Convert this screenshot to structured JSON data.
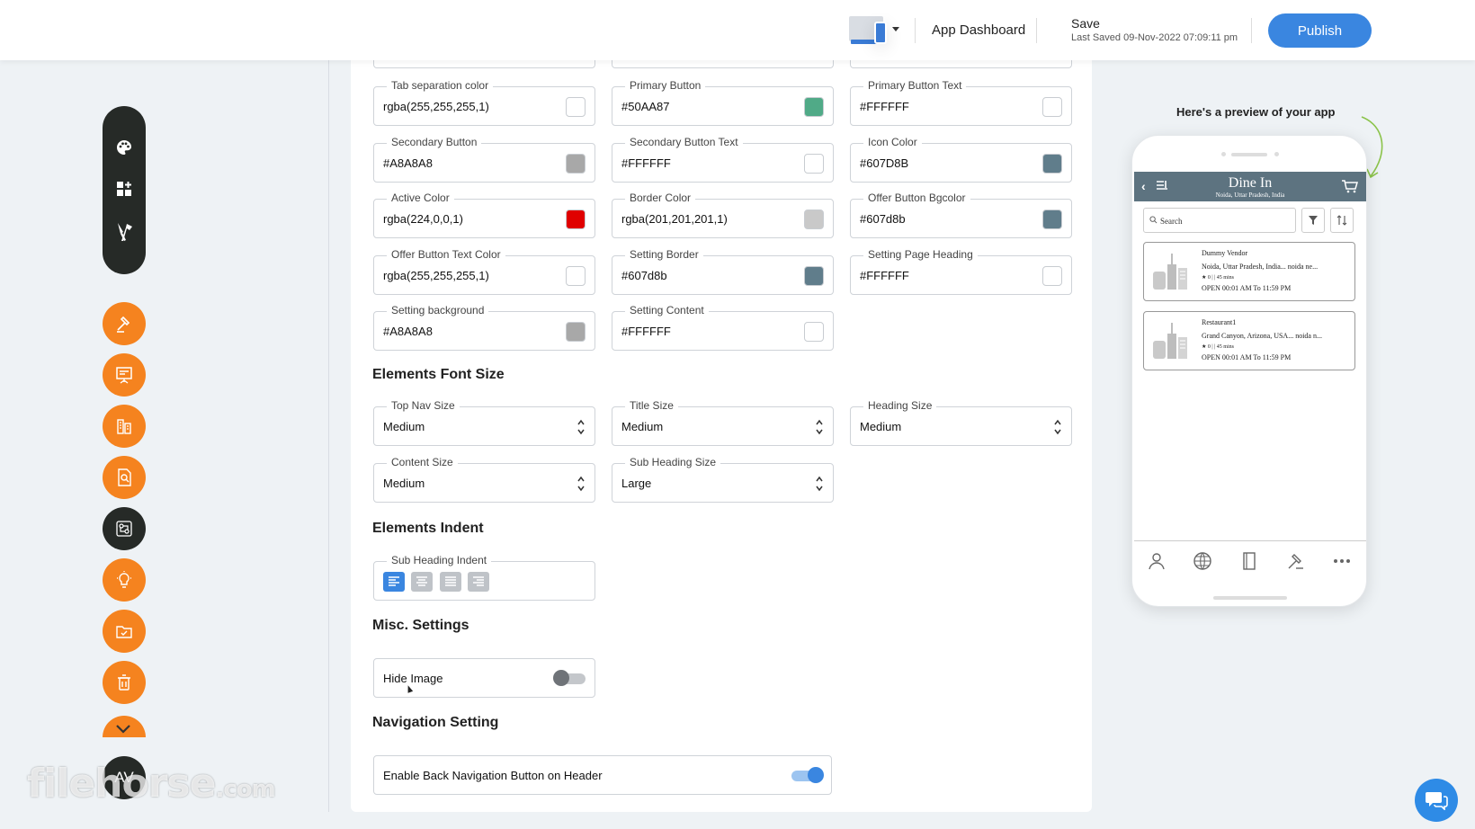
{
  "header": {
    "device_icon": "desktop-mobile-icon",
    "dashboard_label": "App Dashboard",
    "save_title": "Save",
    "last_saved": "Last Saved 09-Nov-2022 07:09:11 pm",
    "publish_label": "Publish",
    "accent": "#3a86e0"
  },
  "sidebar": {
    "pill_icons": [
      "palette-icon",
      "add-widget-icon",
      "tools-icon"
    ],
    "items": [
      "hammer-icon",
      "presentation-icon",
      "building-icon",
      "document-search-icon",
      "workflow-icon",
      "lightbulb-icon",
      "folder-check-icon",
      "trash-icon"
    ],
    "active_item": "workflow-icon",
    "avatar_initials": "AV",
    "accent": "#f5831f"
  },
  "watermark": {
    "main": "filehorse",
    "tld": ".com"
  },
  "colors": {
    "fields": [
      {
        "label": "Tab separation color",
        "value": "rgba(255,255,255,1)",
        "swatch": "#ffffff"
      },
      {
        "label": "Primary Button",
        "value": "#50AA87",
        "swatch": "#50AA87"
      },
      {
        "label": "Primary Button Text",
        "value": "#FFFFFF",
        "swatch": "#ffffff"
      },
      {
        "label": "Secondary Button",
        "value": "#A8A8A8",
        "swatch": "#A8A8A8"
      },
      {
        "label": "Secondary Button Text",
        "value": "#FFFFFF",
        "swatch": "#ffffff"
      },
      {
        "label": "Icon Color",
        "value": "#607D8B",
        "swatch": "#607D8B"
      },
      {
        "label": "Active Color",
        "value": "rgba(224,0,0,1)",
        "swatch": "#e00000"
      },
      {
        "label": "Border Color",
        "value": "rgba(201,201,201,1)",
        "swatch": "#c9c9c9"
      },
      {
        "label": "Offer Button Bgcolor",
        "value": "#607d8b",
        "swatch": "#607d8b"
      },
      {
        "label": "Offer Button Text Color",
        "value": "rgba(255,255,255,1)",
        "swatch": "#ffffff"
      },
      {
        "label": "Setting Border",
        "value": "#607d8b",
        "swatch": "#607d8b"
      },
      {
        "label": "Setting Page Heading",
        "value": "#FFFFFF",
        "swatch": "#ffffff"
      },
      {
        "label": "Setting background",
        "value": "#A8A8A8",
        "swatch": "#A8A8A8"
      },
      {
        "label": "Setting Content",
        "value": "#FFFFFF",
        "swatch": "#ffffff"
      }
    ]
  },
  "font_size": {
    "heading": "Elements Font Size",
    "fields": [
      {
        "label": "Top Nav Size",
        "value": "Medium"
      },
      {
        "label": "Title Size",
        "value": "Medium"
      },
      {
        "label": "Heading Size",
        "value": "Medium"
      },
      {
        "label": "Content Size",
        "value": "Medium"
      },
      {
        "label": "Sub Heading Size",
        "value": "Large"
      }
    ]
  },
  "indent": {
    "heading": "Elements Indent",
    "label": "Sub Heading Indent",
    "options": [
      "align-left-icon",
      "align-center-icon",
      "align-justify-icon",
      "align-right-icon"
    ],
    "selected": "align-left-icon"
  },
  "misc": {
    "heading": "Misc. Settings",
    "hide_image_label": "Hide Image",
    "hide_image_on": false
  },
  "nav": {
    "heading": "Navigation Setting",
    "back_label": "Enable Back Navigation Button on Header",
    "back_on": true
  },
  "preview": {
    "caption": "Here's a preview of your app",
    "title": "Dine In",
    "location": "Noida, Uttar Pradesh, India",
    "search_placeholder": "Search",
    "header_color": "#5d7380",
    "cards": [
      {
        "name": "Dummy Vendor",
        "address": "Noida, Uttar Pradesh, India... noida ne...",
        "rating": "★ 0 | | 45 mins",
        "hours": "OPEN 00:01 AM To 11:59 PM"
      },
      {
        "name": "Restaurant1",
        "address": "Grand Canyon, Arizona, USA... noida n...",
        "rating": "★ 0 | | 45 mins",
        "hours": "OPEN 00:01 AM To 11:59 PM"
      }
    ],
    "tab_icons": [
      "profile-icon",
      "globe-icon",
      "bookmark-icon",
      "auction-icon",
      "more-icon"
    ]
  },
  "chat": {
    "icon": "chat-bubbles-icon"
  }
}
